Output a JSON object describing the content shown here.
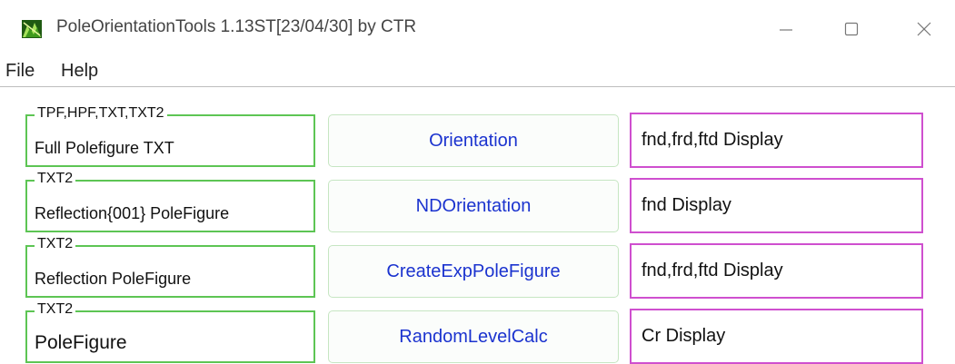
{
  "window": {
    "title": "PoleOrientationTools 1.13ST[23/04/30] by CTR",
    "icon": "poletools-app-icon"
  },
  "menu": [
    "File",
    "Help"
  ],
  "rows": [
    {
      "legend": "TPF,HPF,TXT,TXT2",
      "text": "Full Polefigure TXT",
      "button": "Orientation",
      "display": "fnd,frd,ftd Display"
    },
    {
      "legend": "TXT2",
      "text": "Reflection{001} PoleFigure",
      "button": "NDOrientation",
      "display": "fnd Display"
    },
    {
      "legend": "TXT2",
      "text": "Reflection PoleFigure",
      "button": "CreateExpPoleFigure",
      "display": "fnd,frd,ftd Display"
    },
    {
      "legend": "TXT2",
      "text": "PoleFigure",
      "button": "RandomLevelCalc",
      "display": "Cr Display"
    }
  ],
  "colors": {
    "group_border": "#5dc554",
    "display_border": "#cf4fcf",
    "button_text": "#1b33cf"
  }
}
